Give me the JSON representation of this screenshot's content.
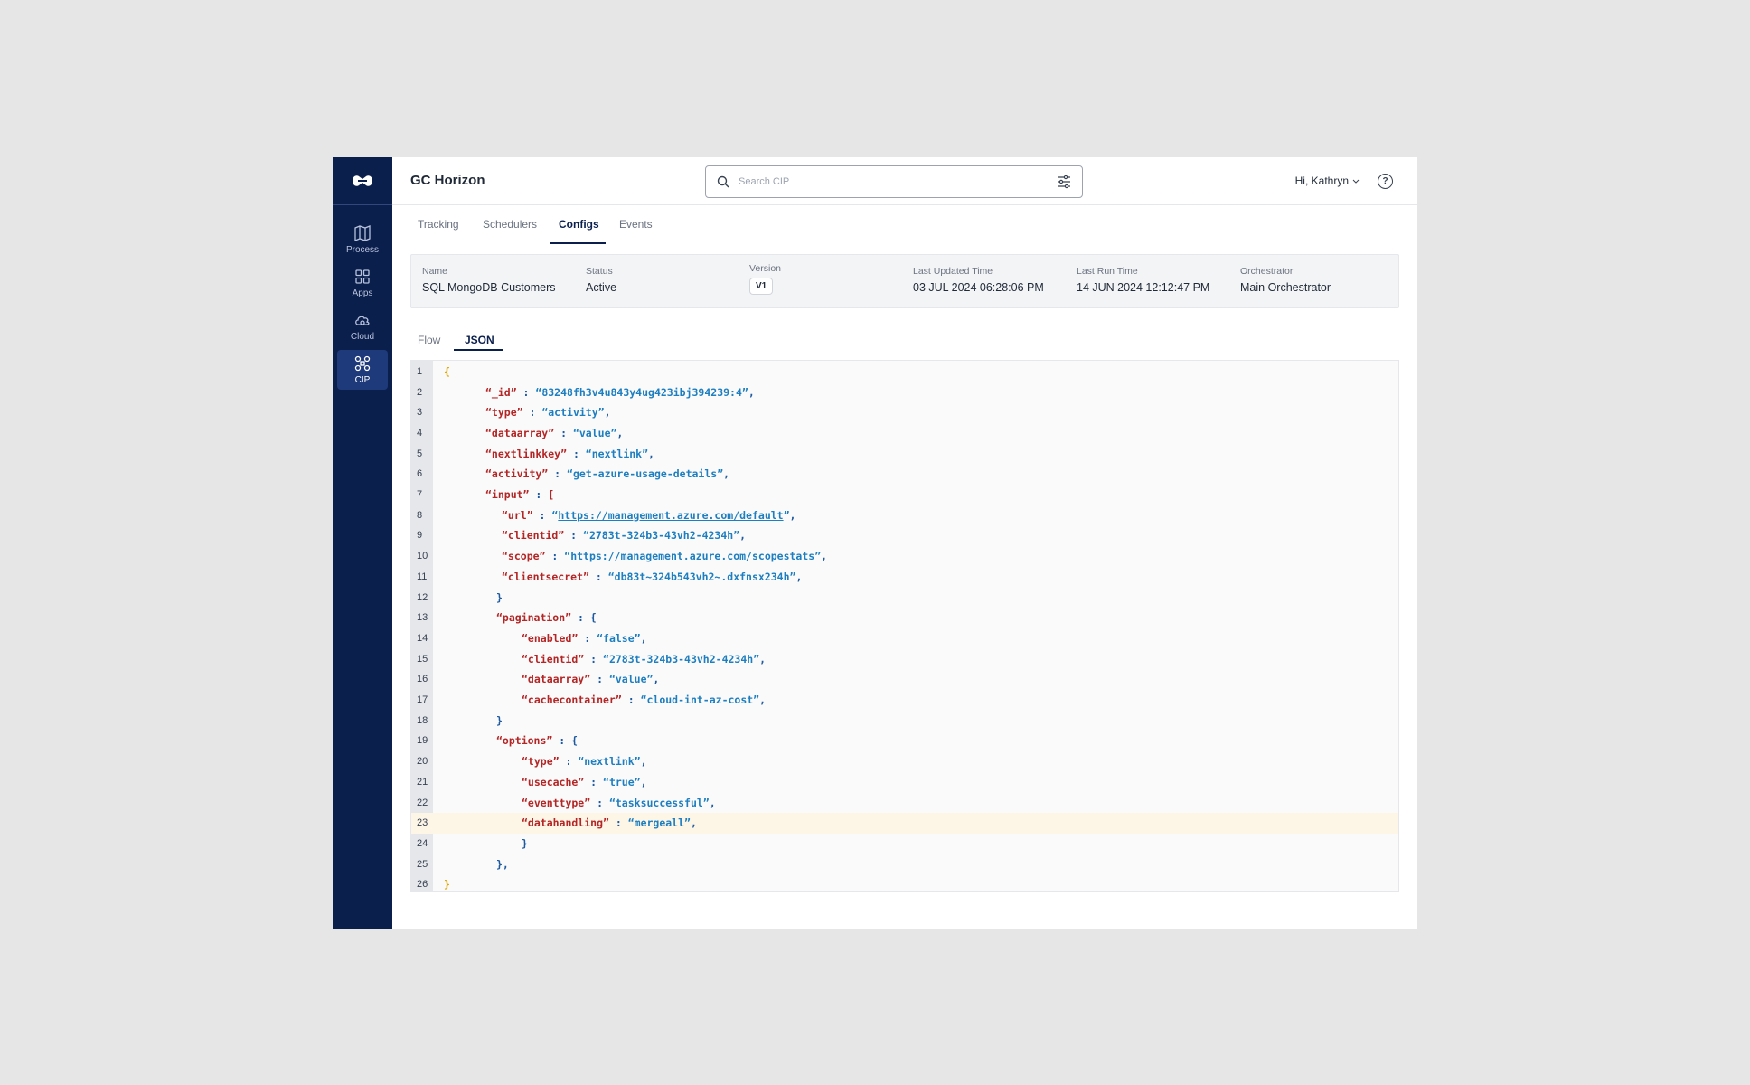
{
  "app": {
    "title": "GC Horizon"
  },
  "search": {
    "placeholder": "Search CIP"
  },
  "user": {
    "greeting": "Hi, Kathryn"
  },
  "sidebar": {
    "items": [
      {
        "label": "Process",
        "icon": "map-icon"
      },
      {
        "label": "Apps",
        "icon": "grid-icon"
      },
      {
        "label": "Cloud",
        "icon": "cloud-icon"
      },
      {
        "label": "CIP",
        "icon": "cip-icon",
        "active": true
      }
    ]
  },
  "tabs": [
    {
      "label": "Tracking"
    },
    {
      "label": "Schedulers"
    },
    {
      "label": "Configs",
      "active": true
    },
    {
      "label": "Events"
    }
  ],
  "info": {
    "name_label": "Name",
    "name": "SQL MongoDB Customers",
    "status_label": "Status",
    "status": "Active",
    "version_label": "Version",
    "version": "V1",
    "updated_label": "Last Updated Time",
    "updated": "03 JUL 2024 06:28:06 PM",
    "run_label": "Last Run Time",
    "run": "14 JUN 2024 12:12:47 PM",
    "orch_label": "Orchestrator",
    "orch": "Main Orchestrator"
  },
  "subtabs": [
    {
      "label": "Flow"
    },
    {
      "label": "JSON",
      "active": true
    }
  ],
  "editor": {
    "highlighted_line": 23,
    "lines": [
      {
        "n": "1",
        "indent": 0,
        "tokens": [
          [
            "brace",
            "{"
          ]
        ]
      },
      {
        "n": "2",
        "indent": 1,
        "tokens": [
          [
            "key",
            "“_id”"
          ],
          [
            "pun",
            " : "
          ],
          [
            "str",
            "“83248fh3v4u843y4ug423ibj394239:4”"
          ],
          [
            "pun",
            ","
          ]
        ]
      },
      {
        "n": "3",
        "indent": 1,
        "tokens": [
          [
            "key",
            "“type”"
          ],
          [
            "pun",
            " : "
          ],
          [
            "str",
            "“activity”"
          ],
          [
            "pun",
            ","
          ]
        ]
      },
      {
        "n": "4",
        "indent": 1,
        "tokens": [
          [
            "key",
            "“dataarray”"
          ],
          [
            "pun",
            " : "
          ],
          [
            "str",
            "“value”"
          ],
          [
            "pun",
            ","
          ]
        ]
      },
      {
        "n": "5",
        "indent": 1,
        "tokens": [
          [
            "key",
            "“nextlinkkey”"
          ],
          [
            "pun",
            " : "
          ],
          [
            "str",
            "“nextlink”"
          ],
          [
            "pun",
            ","
          ]
        ]
      },
      {
        "n": "6",
        "indent": 1,
        "tokens": [
          [
            "key",
            "“activity”"
          ],
          [
            "pun",
            " : "
          ],
          [
            "str",
            "“get-azure-usage-details”"
          ],
          [
            "pun",
            ","
          ]
        ]
      },
      {
        "n": "7",
        "indent": 1,
        "tokens": [
          [
            "key",
            "“input”"
          ],
          [
            "pun",
            " : "
          ],
          [
            "bracket",
            "["
          ]
        ]
      },
      {
        "n": "8",
        "indent": 2,
        "tokens": [
          [
            "key",
            "“url”"
          ],
          [
            "pun",
            " : "
          ],
          [
            "str",
            "“"
          ],
          [
            "lnk",
            "https://management.azure.com/default"
          ],
          [
            "str",
            "”"
          ],
          [
            "pun",
            ","
          ]
        ]
      },
      {
        "n": "9",
        "indent": 2,
        "tokens": [
          [
            "key",
            "“clientid”"
          ],
          [
            "pun",
            " : "
          ],
          [
            "str",
            "“2783t-324b3-43vh2-4234h”"
          ],
          [
            "pun",
            ","
          ]
        ]
      },
      {
        "n": "10",
        "indent": 2,
        "tokens": [
          [
            "key",
            "“scope”"
          ],
          [
            "pun",
            " : "
          ],
          [
            "str",
            "“"
          ],
          [
            "lnk",
            "https://management.azure.com/scopestats"
          ],
          [
            "str",
            "”"
          ],
          [
            "pun",
            ","
          ]
        ]
      },
      {
        "n": "11",
        "indent": 2,
        "tokens": [
          [
            "key",
            "“clientsecret”"
          ],
          [
            "pun",
            " : "
          ],
          [
            "str",
            "“db83t~324b543vh2~.dxfnsx234h”"
          ],
          [
            "pun",
            ","
          ]
        ]
      },
      {
        "n": "12",
        "indent": 3,
        "tokens": [
          [
            "pun",
            "}"
          ]
        ]
      },
      {
        "n": "13",
        "indent": 3,
        "tokens": [
          [
            "key",
            "“pagination”"
          ],
          [
            "pun",
            " : {"
          ]
        ]
      },
      {
        "n": "14",
        "indent": 4,
        "tokens": [
          [
            "key",
            "“enabled”"
          ],
          [
            "pun",
            " : "
          ],
          [
            "str",
            "“false”"
          ],
          [
            "pun",
            ","
          ]
        ]
      },
      {
        "n": "15",
        "indent": 4,
        "tokens": [
          [
            "key",
            "“clientid”"
          ],
          [
            "pun",
            " : "
          ],
          [
            "str",
            "“2783t-324b3-43vh2-4234h”"
          ],
          [
            "pun",
            ","
          ]
        ]
      },
      {
        "n": "16",
        "indent": 4,
        "tokens": [
          [
            "key",
            "“dataarray”"
          ],
          [
            "pun",
            " : "
          ],
          [
            "str",
            "“value”"
          ],
          [
            "pun",
            ","
          ]
        ]
      },
      {
        "n": "17",
        "indent": 4,
        "tokens": [
          [
            "key",
            "“cachecontainer”"
          ],
          [
            "pun",
            " : "
          ],
          [
            "str",
            "“cloud-int-az-cost”"
          ],
          [
            "pun",
            ","
          ]
        ]
      },
      {
        "n": "18",
        "indent": 3,
        "tokens": [
          [
            "pun",
            "}"
          ]
        ]
      },
      {
        "n": "19",
        "indent": 3,
        "tokens": [
          [
            "key",
            "“options”"
          ],
          [
            "pun",
            " : {"
          ]
        ]
      },
      {
        "n": "20",
        "indent": 4,
        "tokens": [
          [
            "key",
            "“type”"
          ],
          [
            "pun",
            " : "
          ],
          [
            "str",
            "“nextlink”"
          ],
          [
            "pun",
            ","
          ]
        ]
      },
      {
        "n": "21",
        "indent": 4,
        "tokens": [
          [
            "key",
            "“usecache”"
          ],
          [
            "pun",
            " : "
          ],
          [
            "str",
            "“true”"
          ],
          [
            "pun",
            ","
          ]
        ]
      },
      {
        "n": "22",
        "indent": 4,
        "tokens": [
          [
            "key",
            "“eventtype”"
          ],
          [
            "pun",
            " : "
          ],
          [
            "str",
            "“tasksuccessful”"
          ],
          [
            "pun",
            ","
          ]
        ]
      },
      {
        "n": "23",
        "indent": 4,
        "tokens": [
          [
            "key",
            "“datahandling”"
          ],
          [
            "pun",
            " : "
          ],
          [
            "str",
            "“mergeall”"
          ],
          [
            "pun",
            ","
          ]
        ]
      },
      {
        "n": "24",
        "indent": 4,
        "tokens": [
          [
            "pun",
            "}"
          ]
        ]
      },
      {
        "n": "25",
        "indent": 3,
        "tokens": [
          [
            "pun",
            "},"
          ]
        ]
      },
      {
        "n": "26",
        "indent": 0,
        "tokens": [
          [
            "brace",
            "}"
          ]
        ]
      }
    ]
  },
  "colors": {
    "sidebar": "#0b1f4d",
    "key": "#b42525",
    "string": "#1d7ec0",
    "highlight": "#fdf5e6"
  }
}
